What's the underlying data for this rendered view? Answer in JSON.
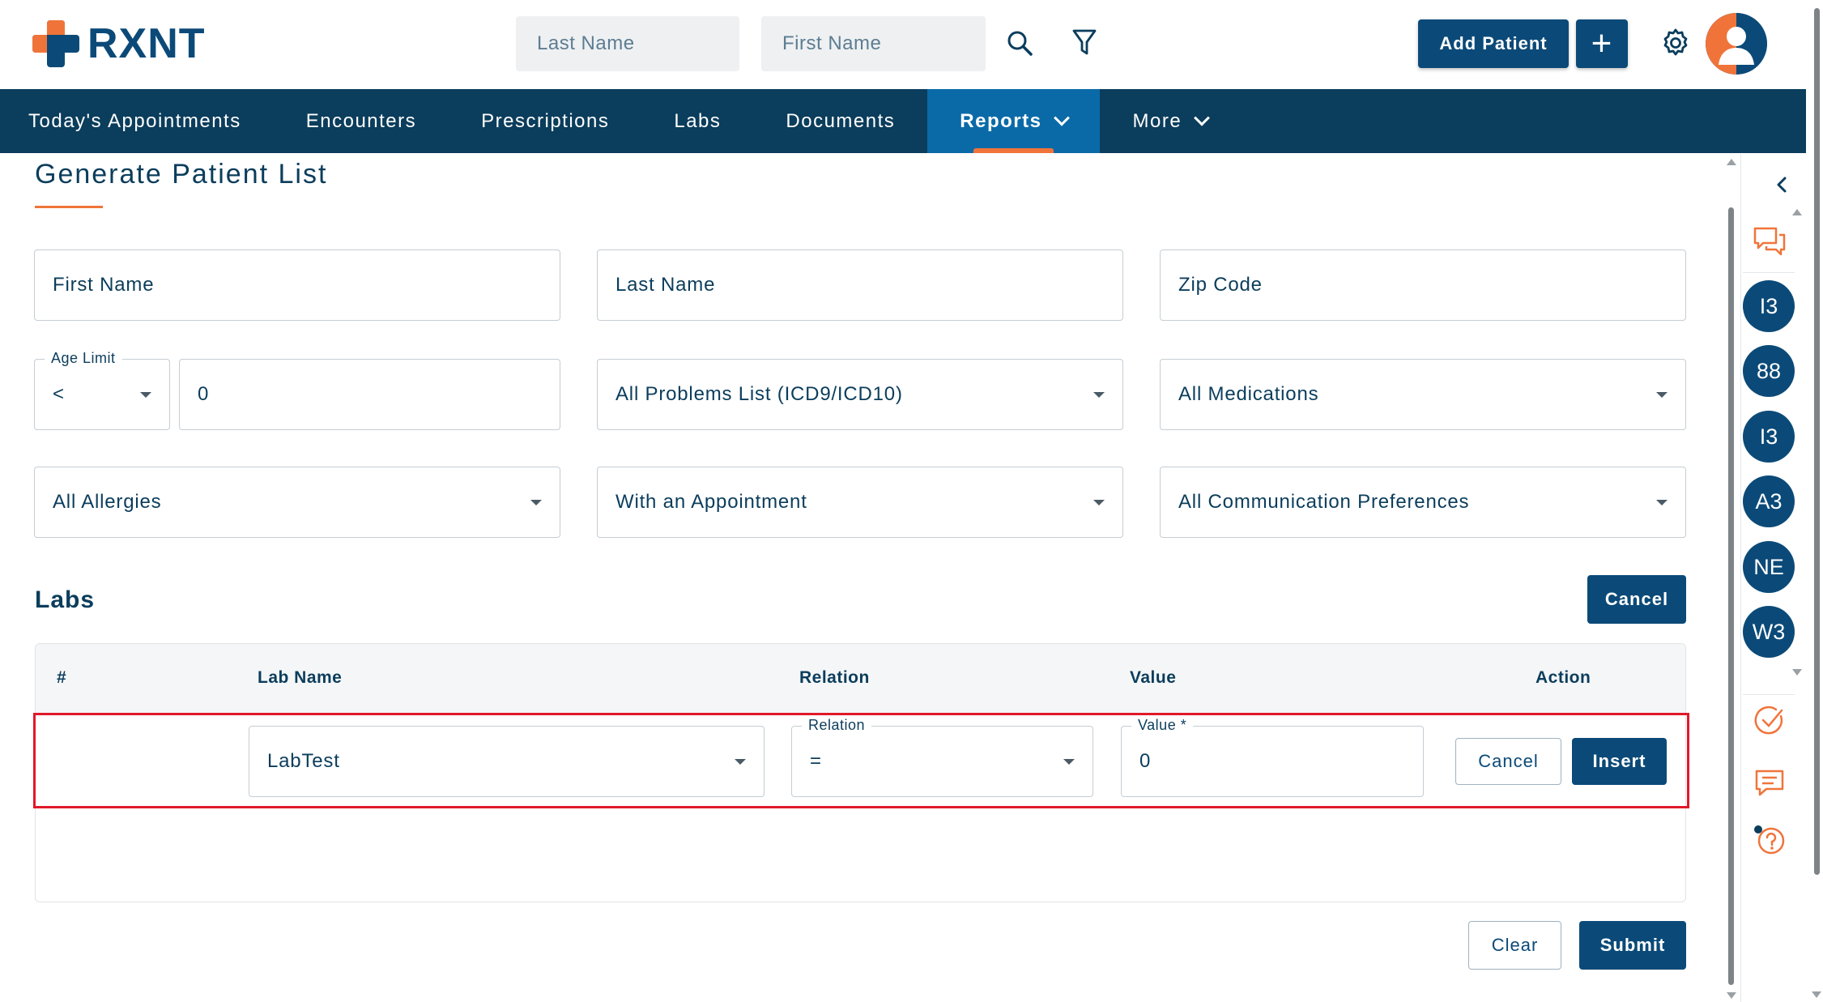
{
  "header": {
    "brand": "RXNT",
    "search_last_name_placeholder": "Last Name",
    "search_first_name_placeholder": "First Name",
    "add_patient_label": "Add Patient",
    "plus_label": "+"
  },
  "nav": {
    "items": [
      {
        "label": "Today's Appointments"
      },
      {
        "label": "Encounters"
      },
      {
        "label": "Prescriptions"
      },
      {
        "label": "Labs"
      },
      {
        "label": "Documents"
      },
      {
        "label": "Reports"
      },
      {
        "label": "More"
      }
    ],
    "active": "Reports"
  },
  "form": {
    "title": "Generate Patient List",
    "first_name_placeholder": "First Name",
    "last_name_placeholder": "Last Name",
    "zip_code_placeholder": "Zip Code",
    "age_limit_label": "Age Limit",
    "age_operator": "<",
    "age_value": "0",
    "problems": "All Problems List (ICD9/ICD10)",
    "medications": "All Medications",
    "allergies": "All Allergies",
    "appointment": "With an Appointment",
    "communication": "All Communication Preferences"
  },
  "labs": {
    "title": "Labs",
    "cancel_label": "Cancel",
    "columns": [
      "#",
      "Lab Name",
      "Relation",
      "Value",
      "Action"
    ],
    "edit_row": {
      "lab_name": "LabTest",
      "relation_label": "Relation",
      "relation": "=",
      "value_label": "Value *",
      "value": "0",
      "cancel_label": "Cancel",
      "insert_label": "Insert"
    }
  },
  "footer": {
    "clear_label": "Clear",
    "submit_label": "Submit"
  },
  "rail": {
    "circles": [
      "I3",
      "88",
      "I3",
      "A3",
      "NE",
      "W3"
    ]
  },
  "colors": {
    "brand_dark": "#0b3d5c",
    "brand_blue": "#0b4a78",
    "accent_orange": "#f0743a",
    "highlight_red": "#e0192a"
  }
}
